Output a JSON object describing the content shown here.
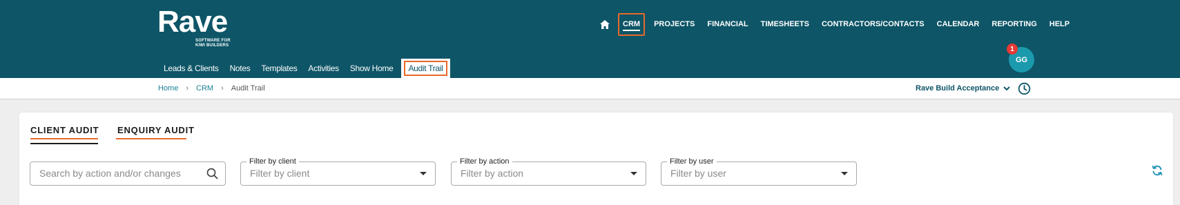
{
  "brand": {
    "name": "Rave",
    "tagline_line1": "SOFTWARE FOR",
    "tagline_line2": "KIWI BUILDERS"
  },
  "main_nav": {
    "home_icon": "home-icon",
    "items": [
      {
        "label": "CRM",
        "active": true
      },
      {
        "label": "PROJECTS"
      },
      {
        "label": "FINANCIAL"
      },
      {
        "label": "TIMESHEETS"
      },
      {
        "label": "CONTRACTORS/CONTACTS"
      },
      {
        "label": "CALENDAR"
      },
      {
        "label": "REPORTING"
      },
      {
        "label": "HELP"
      }
    ]
  },
  "sub_nav": {
    "items": [
      {
        "label": "Leads & Clients"
      },
      {
        "label": "Notes"
      },
      {
        "label": "Templates"
      },
      {
        "label": "Activities"
      },
      {
        "label": "Show Home"
      },
      {
        "label": "Audit Trail",
        "active": true
      }
    ]
  },
  "user": {
    "initials": "GG",
    "notification_count": "1"
  },
  "breadcrumb": {
    "items": [
      "Home",
      "CRM",
      "Audit Trail"
    ],
    "separator": "›"
  },
  "project_selector": {
    "value": "Rave Build Acceptance",
    "icon": "chevron-down-icon"
  },
  "tabs": {
    "client_audit": "CLIENT AUDIT",
    "enquiry_audit": "ENQUIRY AUDIT",
    "active": "client_audit"
  },
  "filters": {
    "search": {
      "placeholder": "Search by action and/or changes",
      "icon": "search-icon"
    },
    "client": {
      "label": "Filter by client",
      "placeholder": "Filter by client"
    },
    "action": {
      "label": "Filter by action",
      "placeholder": "Filter by action"
    },
    "user": {
      "label": "Filter by user",
      "placeholder": "Filter by user"
    }
  },
  "icons": {
    "refresh": "refresh-icon",
    "history": "clock-history-icon"
  },
  "colors": {
    "header_bg": "#0d5567",
    "accent_orange": "#e8692a",
    "avatar_bg": "#1c9aad",
    "badge_red": "#e53935",
    "link_teal": "#1a7f96"
  }
}
